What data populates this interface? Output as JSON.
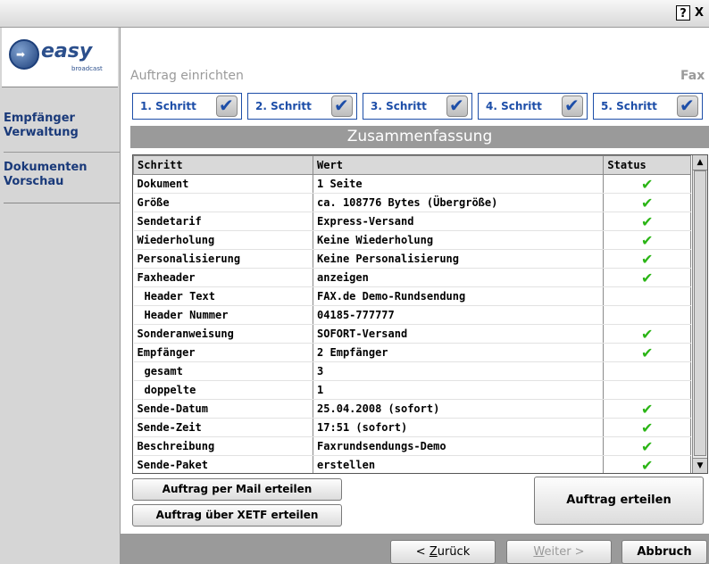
{
  "titlebar": {
    "help_label": "?",
    "close_label": "X"
  },
  "logo": {
    "text": "easy",
    "subtext": "broadcast"
  },
  "sidebar": {
    "items": [
      {
        "line1": "Empfänger",
        "line2": "Verwaltung"
      },
      {
        "line1": "Dokumenten",
        "line2": "Vorschau"
      }
    ]
  },
  "header": {
    "title": "Auftrag einrichten",
    "right_text": "Fax"
  },
  "steps": [
    {
      "label": "1. Schritt",
      "done": true
    },
    {
      "label": "2. Schritt",
      "done": true
    },
    {
      "label": "3. Schritt",
      "done": true
    },
    {
      "label": "4. Schritt",
      "done": true
    },
    {
      "label": "5. Schritt",
      "done": true
    }
  ],
  "summary": {
    "title": "Zusammenfassung"
  },
  "table": {
    "columns": [
      "Schritt",
      "Wert",
      "Status"
    ],
    "rows": [
      {
        "step": "Dokument",
        "value": "1 Seite",
        "status": "✔",
        "indent": false
      },
      {
        "step": "Größe",
        "value": "ca. 108776 Bytes (Übergröße)",
        "status": "✔",
        "indent": false
      },
      {
        "step": "Sendetarif",
        "value": "Express-Versand",
        "status": "✔",
        "indent": false
      },
      {
        "step": "Wiederholung",
        "value": "Keine Wiederholung",
        "status": "✔",
        "indent": false
      },
      {
        "step": "Personalisierung",
        "value": "Keine Personalisierung",
        "status": "✔",
        "indent": false
      },
      {
        "step": "Faxheader",
        "value": "anzeigen",
        "status": "✔",
        "indent": false
      },
      {
        "step": "Header Text",
        "value": "FAX.de Demo-Rundsendung",
        "status": "",
        "indent": true
      },
      {
        "step": "Header Nummer",
        "value": "04185-777777",
        "status": "",
        "indent": true
      },
      {
        "step": "Sonderanweisung",
        "value": "SOFORT-Versand",
        "status": "✔",
        "indent": false
      },
      {
        "step": "Empfänger",
        "value": "2 Empfänger",
        "status": "✔",
        "indent": false
      },
      {
        "step": "gesamt",
        "value": "3",
        "status": "",
        "indent": true
      },
      {
        "step": "doppelte",
        "value": "1",
        "status": "",
        "indent": true
      },
      {
        "step": "Sende-Datum",
        "value": "25.04.2008 (sofort)",
        "status": "✔",
        "indent": false
      },
      {
        "step": "Sende-Zeit",
        "value": "17:51 (sofort)",
        "status": "✔",
        "indent": false
      },
      {
        "step": "Beschreibung",
        "value": "Faxrundsendungs-Demo",
        "status": "✔",
        "indent": false
      },
      {
        "step": "Sende-Paket",
        "value": "erstellen",
        "status": "✔",
        "indent": false
      }
    ]
  },
  "actions": {
    "mail_label": "Auftrag per Mail erteilen",
    "xetf_label": "Auftrag über XETF erteilen",
    "submit_label": "Auftrag erteilen"
  },
  "nav": {
    "back_prefix": "< ",
    "back_underline": "Z",
    "back_rest": "urück",
    "next_underline": "W",
    "next_rest": "eiter >",
    "cancel_label": "Abbruch"
  },
  "colors": {
    "accent": "#1d4ea8",
    "check": "#2bb516",
    "bar": "#9a9a9a"
  }
}
